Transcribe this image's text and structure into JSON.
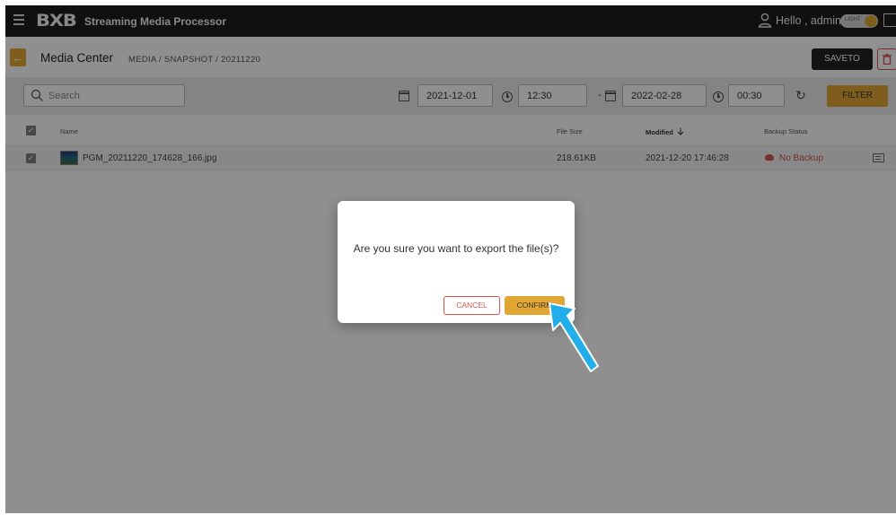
{
  "topbar": {
    "logo": "BXB",
    "title": "Streaming Media Processor",
    "greeting": "Hello , admin",
    "theme_toggle_label": "LIGHT"
  },
  "header": {
    "page_title": "Media Center",
    "breadcrumb": "MEDIA  /  SNAPSHOT  /  20211220",
    "saveto_label": "SAVETO"
  },
  "filters": {
    "search_placeholder": "Search",
    "start_date": "2021-12-01",
    "start_time": "12:30",
    "separator": "-",
    "end_date": "2022-02-28",
    "end_time": "00:30",
    "filter_label": "FILTER"
  },
  "table": {
    "columns": {
      "name": "Name",
      "size": "File Size",
      "modified": "Modified",
      "modified_sort_icon": "arrow-down",
      "backup": "Backup Status"
    },
    "rows": [
      {
        "name": "PGM_20211220_174628_166.jpg",
        "size": "218.61KB",
        "modified": "2021-12-20 17:46:28",
        "backup": "No Backup",
        "checked": true
      }
    ]
  },
  "dialog": {
    "message": "Are you sure you want to export the file(s)?",
    "cancel_label": "CANCEL",
    "confirm_label": "CONFIRM"
  },
  "colors": {
    "accent": "#e2a732",
    "danger": "#d9534f",
    "topbar": "#1e1e1e",
    "annotation_arrow": "#22aee8"
  }
}
